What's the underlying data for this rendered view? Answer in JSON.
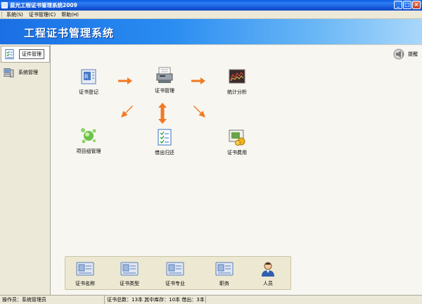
{
  "window": {
    "title": "蓝光工程证书管理系统2009",
    "icon": "app-icon",
    "buttons": [
      "minimize",
      "maximize",
      "close"
    ]
  },
  "menubar": {
    "items": [
      {
        "label": "系统(S)",
        "shortcut": "S"
      },
      {
        "label": "证书管理(C)",
        "shortcut": "C"
      },
      {
        "label": "帮助(H)",
        "shortcut": "H"
      }
    ]
  },
  "banner": {
    "title": "工程证书管理系统"
  },
  "sidebar": {
    "items": [
      {
        "label": "证件管理",
        "icon": "checklist-icon",
        "active": true
      },
      {
        "label": "系统管理",
        "icon": "computer-icon",
        "active": false
      }
    ]
  },
  "help": {
    "label": "提醒",
    "icon": "speaker-icon"
  },
  "modules": [
    {
      "label": "证书登记",
      "icon": "register-icon"
    },
    {
      "label": "证书管理",
      "icon": "scanner-icon"
    },
    {
      "label": "统计分析",
      "icon": "chart-icon"
    },
    {
      "label": "项目组管理",
      "icon": "group-icon"
    },
    {
      "label": "借出归还",
      "icon": "checklist-icon"
    },
    {
      "label": "证书费用",
      "icon": "certificate-fee-icon"
    }
  ],
  "bottom_modules": [
    {
      "label": "证书名称",
      "icon": "id-card-icon"
    },
    {
      "label": "证书类型",
      "icon": "id-card-icon"
    },
    {
      "label": "证书专业",
      "icon": "id-card-icon"
    },
    {
      "label": "职务",
      "icon": "id-card-icon"
    },
    {
      "label": "人员",
      "icon": "person-icon"
    }
  ],
  "statusbar": {
    "operator": "操作员：系统管理员",
    "summary": "证书总数：13本  其中库存：10本  借出：3本"
  },
  "colors": {
    "arrow": "#f07a22",
    "banner_start": "#1a6fe4",
    "banner_end": "#a9d7fb"
  }
}
